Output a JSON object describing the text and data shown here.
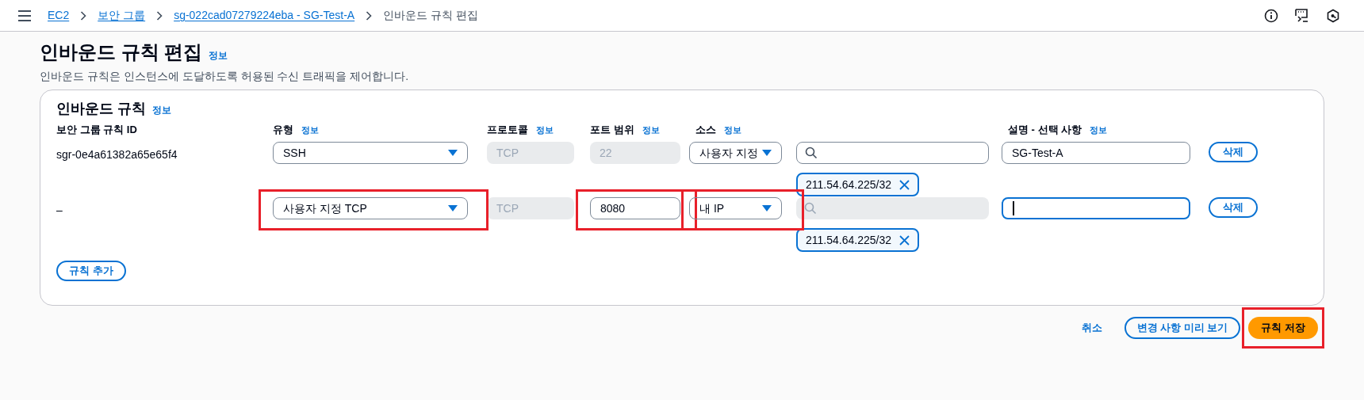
{
  "breadcrumbs": [
    {
      "label": "EC2",
      "link": true
    },
    {
      "label": "보안 그룹",
      "link": true
    },
    {
      "label": "sg-022cad07279224eba - SG-Test-A",
      "link": true
    },
    {
      "label": "인바운드 규칙 편집",
      "link": false
    }
  ],
  "page": {
    "title": "인바운드 규칙 편집",
    "info_link": "정보",
    "description": "인바운드 규칙은 인스턴스에 도달하도록 허용된 수신 트래픽을 제어합니다."
  },
  "panel": {
    "title": "인바운드 규칙",
    "info_link": "정보",
    "columns": [
      {
        "label": "보안 그룹 규칙 ID"
      },
      {
        "label": "유형",
        "info_link": "정보"
      },
      {
        "label": "프로토콜",
        "info_link": "정보"
      },
      {
        "label": "포트 범위",
        "info_link": "정보"
      },
      {
        "label": "소스",
        "info_link": "정보"
      },
      {
        "label": "설명 - 선택 사항",
        "info_link": "정보"
      }
    ]
  },
  "rules": [
    {
      "id": "sgr-0e4a61382a65e65f4",
      "type": "SSH",
      "protocol": "TCP",
      "port": "22",
      "port_disabled": true,
      "source": "사용자 지정",
      "search_disabled": false,
      "chips": [
        "211.54.64.225/32"
      ],
      "description": "SG-Test-A",
      "description_focused": false,
      "delete": "삭제",
      "type_highlighted": false,
      "port_highlighted": false,
      "source_highlighted": false
    },
    {
      "id": "–",
      "type": "사용자 지정 TCP",
      "protocol": "TCP",
      "port": "8080",
      "port_disabled": false,
      "source": "내 IP",
      "search_disabled": true,
      "chips": [
        "211.54.64.225/32"
      ],
      "description_focused": true,
      "delete": "삭제",
      "type_highlighted": true,
      "port_highlighted": true,
      "source_highlighted": true
    }
  ],
  "add_rule": "규칙 추가",
  "footer": {
    "cancel": "취소",
    "preview": "변경 사항 미리 보기",
    "save": "규칙 저장",
    "save_highlighted": true
  }
}
